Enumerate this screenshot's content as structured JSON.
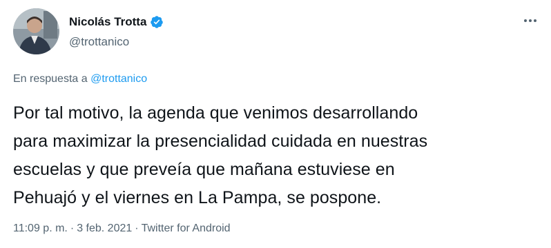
{
  "author": {
    "display_name": "Nicolás Trotta",
    "handle": "@trottanico",
    "verified_icon": "verified-badge-icon",
    "avatar_icon": "avatar-photo"
  },
  "reply": {
    "prefix": "En respuesta a",
    "mention": "@trottanico"
  },
  "tweet": {
    "text": "Por tal motivo, la agenda que venimos desarrollando\npara maximizar la presencialidad cuidada en nuestras\nescuelas y que preveía que mañana estuviese en\nPehuajó y el viernes en La Pampa, se pospone."
  },
  "meta": {
    "time": "11:09 p. m.",
    "separator": "·",
    "date": "3 feb. 2021",
    "source": "Twitter for Android"
  },
  "colors": {
    "accent": "#1d9bf0",
    "text": "#0f1419",
    "secondary": "#536471"
  }
}
